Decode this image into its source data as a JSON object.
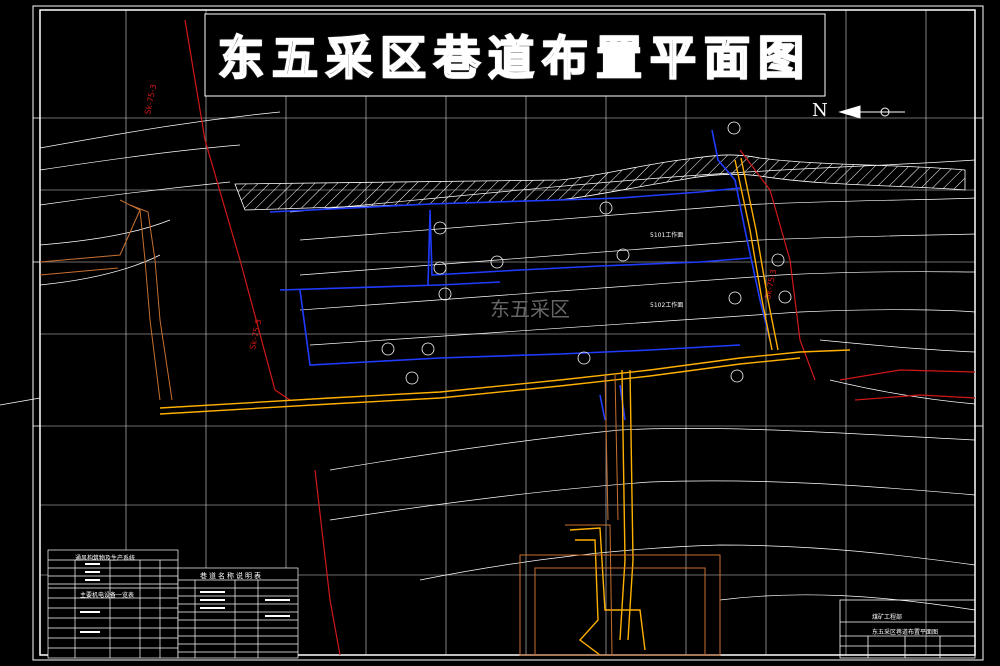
{
  "drawing": {
    "title": "东五采区巷道布置平面图",
    "north_label": "N",
    "watermark": "东五采区",
    "area_labels": [
      "5101工作面",
      "5102工作面"
    ]
  },
  "title_block": {
    "company": "煤矿工程部",
    "drawing_name": "东五采区巷道布置平面图"
  },
  "legend_tables": {
    "ventilation_title": "通风构筑物及生产系统",
    "power_title": "主要机电设备一览表",
    "roadway_title": "巷道名称说明表"
  },
  "colors": {
    "background": "#000000",
    "grid": "#ffffff",
    "roadway_blue": "#1f3cff",
    "main_roadway": "#ffb000",
    "boundary_red": "#d01818",
    "brown_lines": "#c87030"
  }
}
